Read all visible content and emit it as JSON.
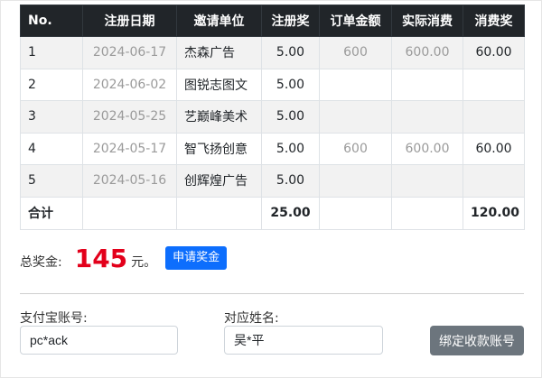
{
  "table": {
    "headers": [
      "No.",
      "注册日期",
      "邀请单位",
      "注册奖",
      "订单金额",
      "实际消费",
      "消费奖"
    ],
    "rows": [
      {
        "no": "1",
        "date": "2024-06-17",
        "unit": "杰森广告",
        "reg_bonus": "5.00",
        "order_amount": "600",
        "actual_spend": "600.00",
        "spend_bonus": "60.00"
      },
      {
        "no": "2",
        "date": "2024-06-02",
        "unit": "图锐志图文",
        "reg_bonus": "5.00",
        "order_amount": "",
        "actual_spend": "",
        "spend_bonus": ""
      },
      {
        "no": "3",
        "date": "2024-05-25",
        "unit": "艺巅峰美术",
        "reg_bonus": "5.00",
        "order_amount": "",
        "actual_spend": "",
        "spend_bonus": ""
      },
      {
        "no": "4",
        "date": "2024-05-17",
        "unit": "智飞扬创意",
        "reg_bonus": "5.00",
        "order_amount": "600",
        "actual_spend": "600.00",
        "spend_bonus": "60.00"
      },
      {
        "no": "5",
        "date": "2024-05-16",
        "unit": "创辉煌广告",
        "reg_bonus": "5.00",
        "order_amount": "",
        "actual_spend": "",
        "spend_bonus": ""
      }
    ],
    "total": {
      "label": "合计",
      "reg_bonus": "25.00",
      "spend_bonus": "120.00"
    }
  },
  "summary": {
    "label": "总奖金:",
    "amount": "145",
    "unit": "元。",
    "apply_label": "申请奖金"
  },
  "form": {
    "alipay_label": "支付宝账号:",
    "alipay_value": "pc*ack",
    "name_label": "对应姓名:",
    "name_value": "吴*平",
    "bind_label": "绑定收款账号"
  },
  "colors": {
    "header_bg": "#212529",
    "amount_red": "#e3001b",
    "apply_blue": "#0d6efd",
    "bind_gray": "#6c757d"
  }
}
